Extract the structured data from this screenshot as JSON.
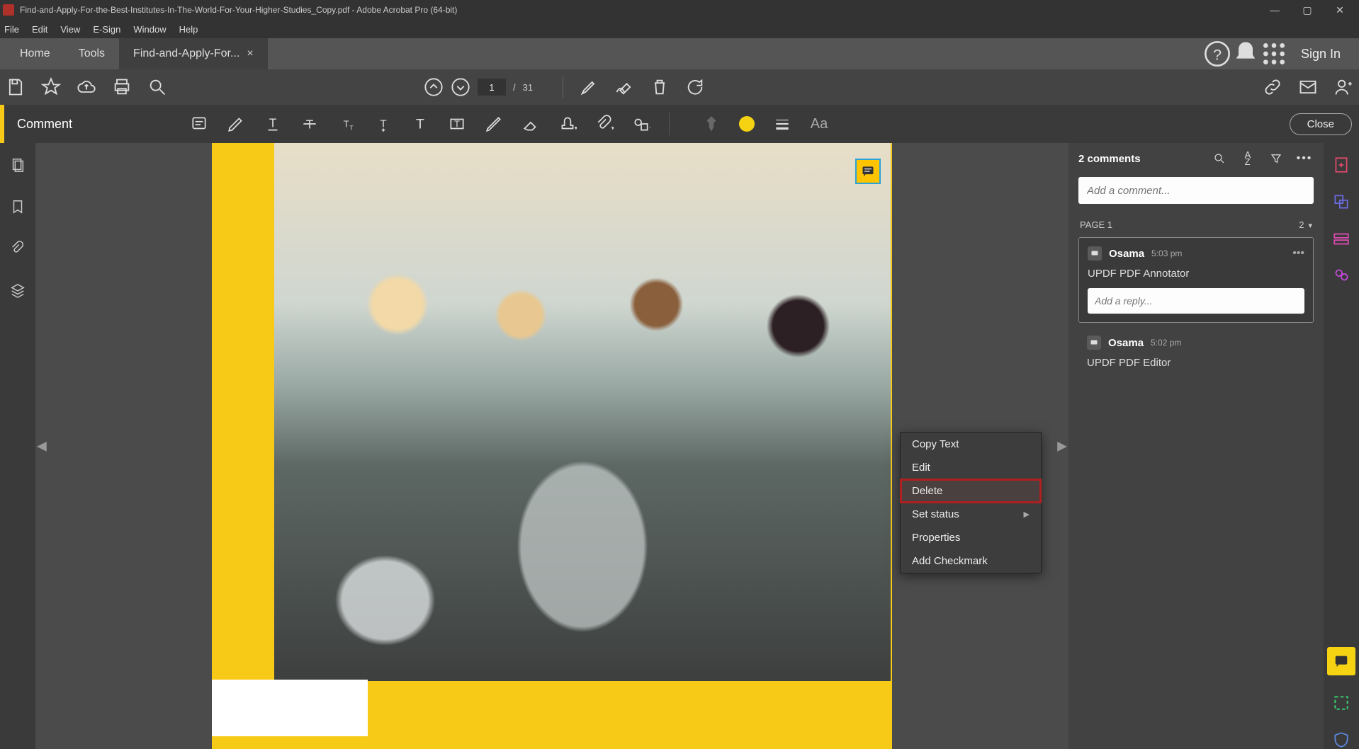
{
  "window": {
    "title": "Find-and-Apply-For-the-Best-Institutes-In-The-World-For-Your-Higher-Studies_Copy.pdf - Adobe Acrobat Pro (64-bit)"
  },
  "menu": {
    "file": "File",
    "edit": "Edit",
    "view": "View",
    "esign": "E-Sign",
    "window": "Window",
    "help": "Help"
  },
  "header": {
    "home": "Home",
    "tools": "Tools",
    "tab_label": "Find-and-Apply-For...",
    "signin": "Sign In"
  },
  "pager": {
    "current": "1",
    "sep": "/",
    "total": "31"
  },
  "comment_bar": {
    "title": "Comment",
    "close": "Close"
  },
  "comments_panel": {
    "title": "2 comments",
    "input_placeholder": "Add a comment...",
    "page_label": "PAGE 1",
    "page_count": "2",
    "reply_placeholder": "Add a reply...",
    "items": [
      {
        "author": "Osama",
        "time": "5:03 pm",
        "body": "UPDF PDF Annotator"
      },
      {
        "author": "Osama",
        "time": "5:02 pm",
        "body": "UPDF PDF Editor"
      }
    ]
  },
  "context_menu": {
    "copy_text": "Copy Text",
    "edit": "Edit",
    "delete": "Delete",
    "set_status": "Set status",
    "properties": "Properties",
    "add_checkmark": "Add Checkmark"
  }
}
